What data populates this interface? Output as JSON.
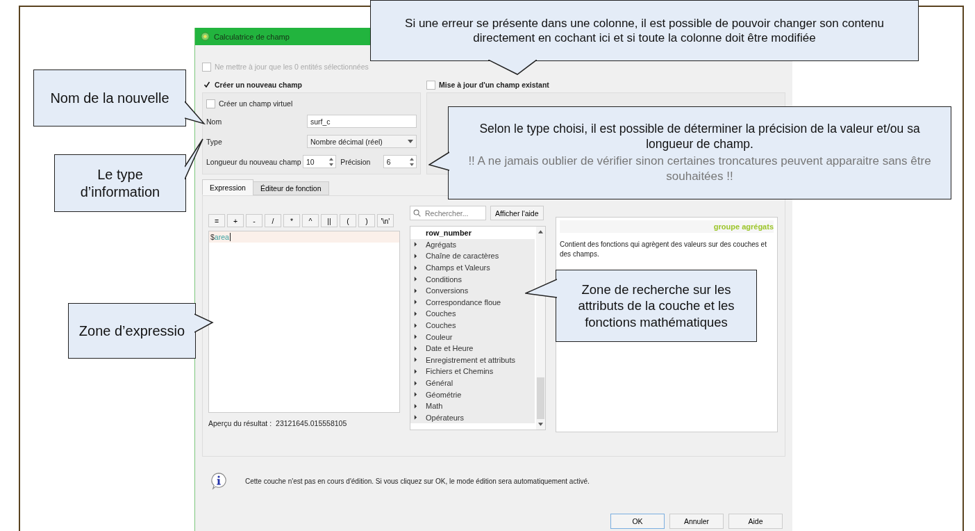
{
  "dialog": {
    "title": "Calculatrice de champ",
    "only_selected": {
      "label": "Ne mettre à jour que les 0 entités sélectionnées",
      "checked": false,
      "disabled": true
    },
    "create_new": {
      "label": "Créer un nouveau champ",
      "checked": true
    },
    "virtual": {
      "label": "Créer un champ virtuel",
      "checked": false
    },
    "fields": {
      "name_label": "Nom",
      "name_value": "surf_c",
      "type_label": "Type",
      "type_value": "Nombre décimal (réel)",
      "length_label": "Longueur du nouveau champ",
      "length_value": "10",
      "precision_label": "Précision",
      "precision_value": "6"
    },
    "update_existing": {
      "label": "Mise à jour d'un champ existant",
      "checked": false
    },
    "tabs": [
      {
        "label": "Expression",
        "selected": true
      },
      {
        "label": "Éditeur de fonction",
        "selected": false
      }
    ],
    "operators": [
      "=",
      "+",
      "-",
      "/",
      "*",
      "^",
      "||",
      "(",
      ")",
      "'\\n'"
    ],
    "expression": [
      {
        "text": "$",
        "kind": "symbol"
      },
      {
        "text": "area",
        "kind": "variable"
      }
    ],
    "preview_label": "Aperçu du résultat :",
    "preview_value": "23121645.015558105",
    "search": {
      "placeholder": "Rechercher..."
    },
    "help_button": "Afficher l'aide",
    "tree": [
      {
        "label": "row_number",
        "kind": "field"
      },
      {
        "label": "Agrégats",
        "kind": "group",
        "expanded": false
      },
      {
        "label": "Chaîne de caractères",
        "kind": "group",
        "expanded": false
      },
      {
        "label": "Champs et Valeurs",
        "kind": "group",
        "expanded": false
      },
      {
        "label": "Conditions",
        "kind": "group",
        "expanded": false
      },
      {
        "label": "Conversions",
        "kind": "group",
        "expanded": false
      },
      {
        "label": "Correspondance floue",
        "kind": "group",
        "expanded": false
      },
      {
        "label": "Couches",
        "kind": "group",
        "expanded": false
      },
      {
        "label": "Couches",
        "kind": "group",
        "expanded": false
      },
      {
        "label": "Couleur",
        "kind": "group",
        "expanded": false
      },
      {
        "label": "Date et Heure",
        "kind": "group",
        "expanded": false
      },
      {
        "label": "Enregistrement et attributs",
        "kind": "group",
        "expanded": false
      },
      {
        "label": "Fichiers et Chemins",
        "kind": "group",
        "expanded": false
      },
      {
        "label": "Général",
        "kind": "group",
        "expanded": false
      },
      {
        "label": "Géométrie",
        "kind": "group",
        "expanded": false
      },
      {
        "label": "Math",
        "kind": "group",
        "expanded": false
      },
      {
        "label": "Opérateurs",
        "kind": "group",
        "expanded": false
      }
    ],
    "help": {
      "title": "groupe agrégats",
      "text": "Contient des fonctions qui agrègent des valeurs sur des couches et des champs."
    },
    "info": "Cette couche n'est pas en cours d'édition. Si vous cliquez sur OK, le mode édition sera automatiquement activé.",
    "buttons": [
      "OK",
      "Annuler",
      "Aide"
    ]
  },
  "callouts": [
    {
      "text": "Si une erreur se présente dans une colonne, il est possible de pouvoir changer son contenu directement en cochant ici et si toute la colonne doit être modifiée"
    },
    {
      "text": "Nom de la nouvelle"
    },
    {
      "text": "Le type d’information"
    },
    {
      "text": "Zone d’expressio"
    },
    {
      "text": "Selon le type choisi, il est possible de déterminer la précision de la valeur et/ou sa longueur de champ.",
      "note": "!! A ne jamais oublier de vérifier sinon certaines troncatures peuvent apparaitre sans être souhaitées !!"
    },
    {
      "text": "Zone de recherche sur les attributs de la couche et les fonctions mathématiques"
    }
  ]
}
